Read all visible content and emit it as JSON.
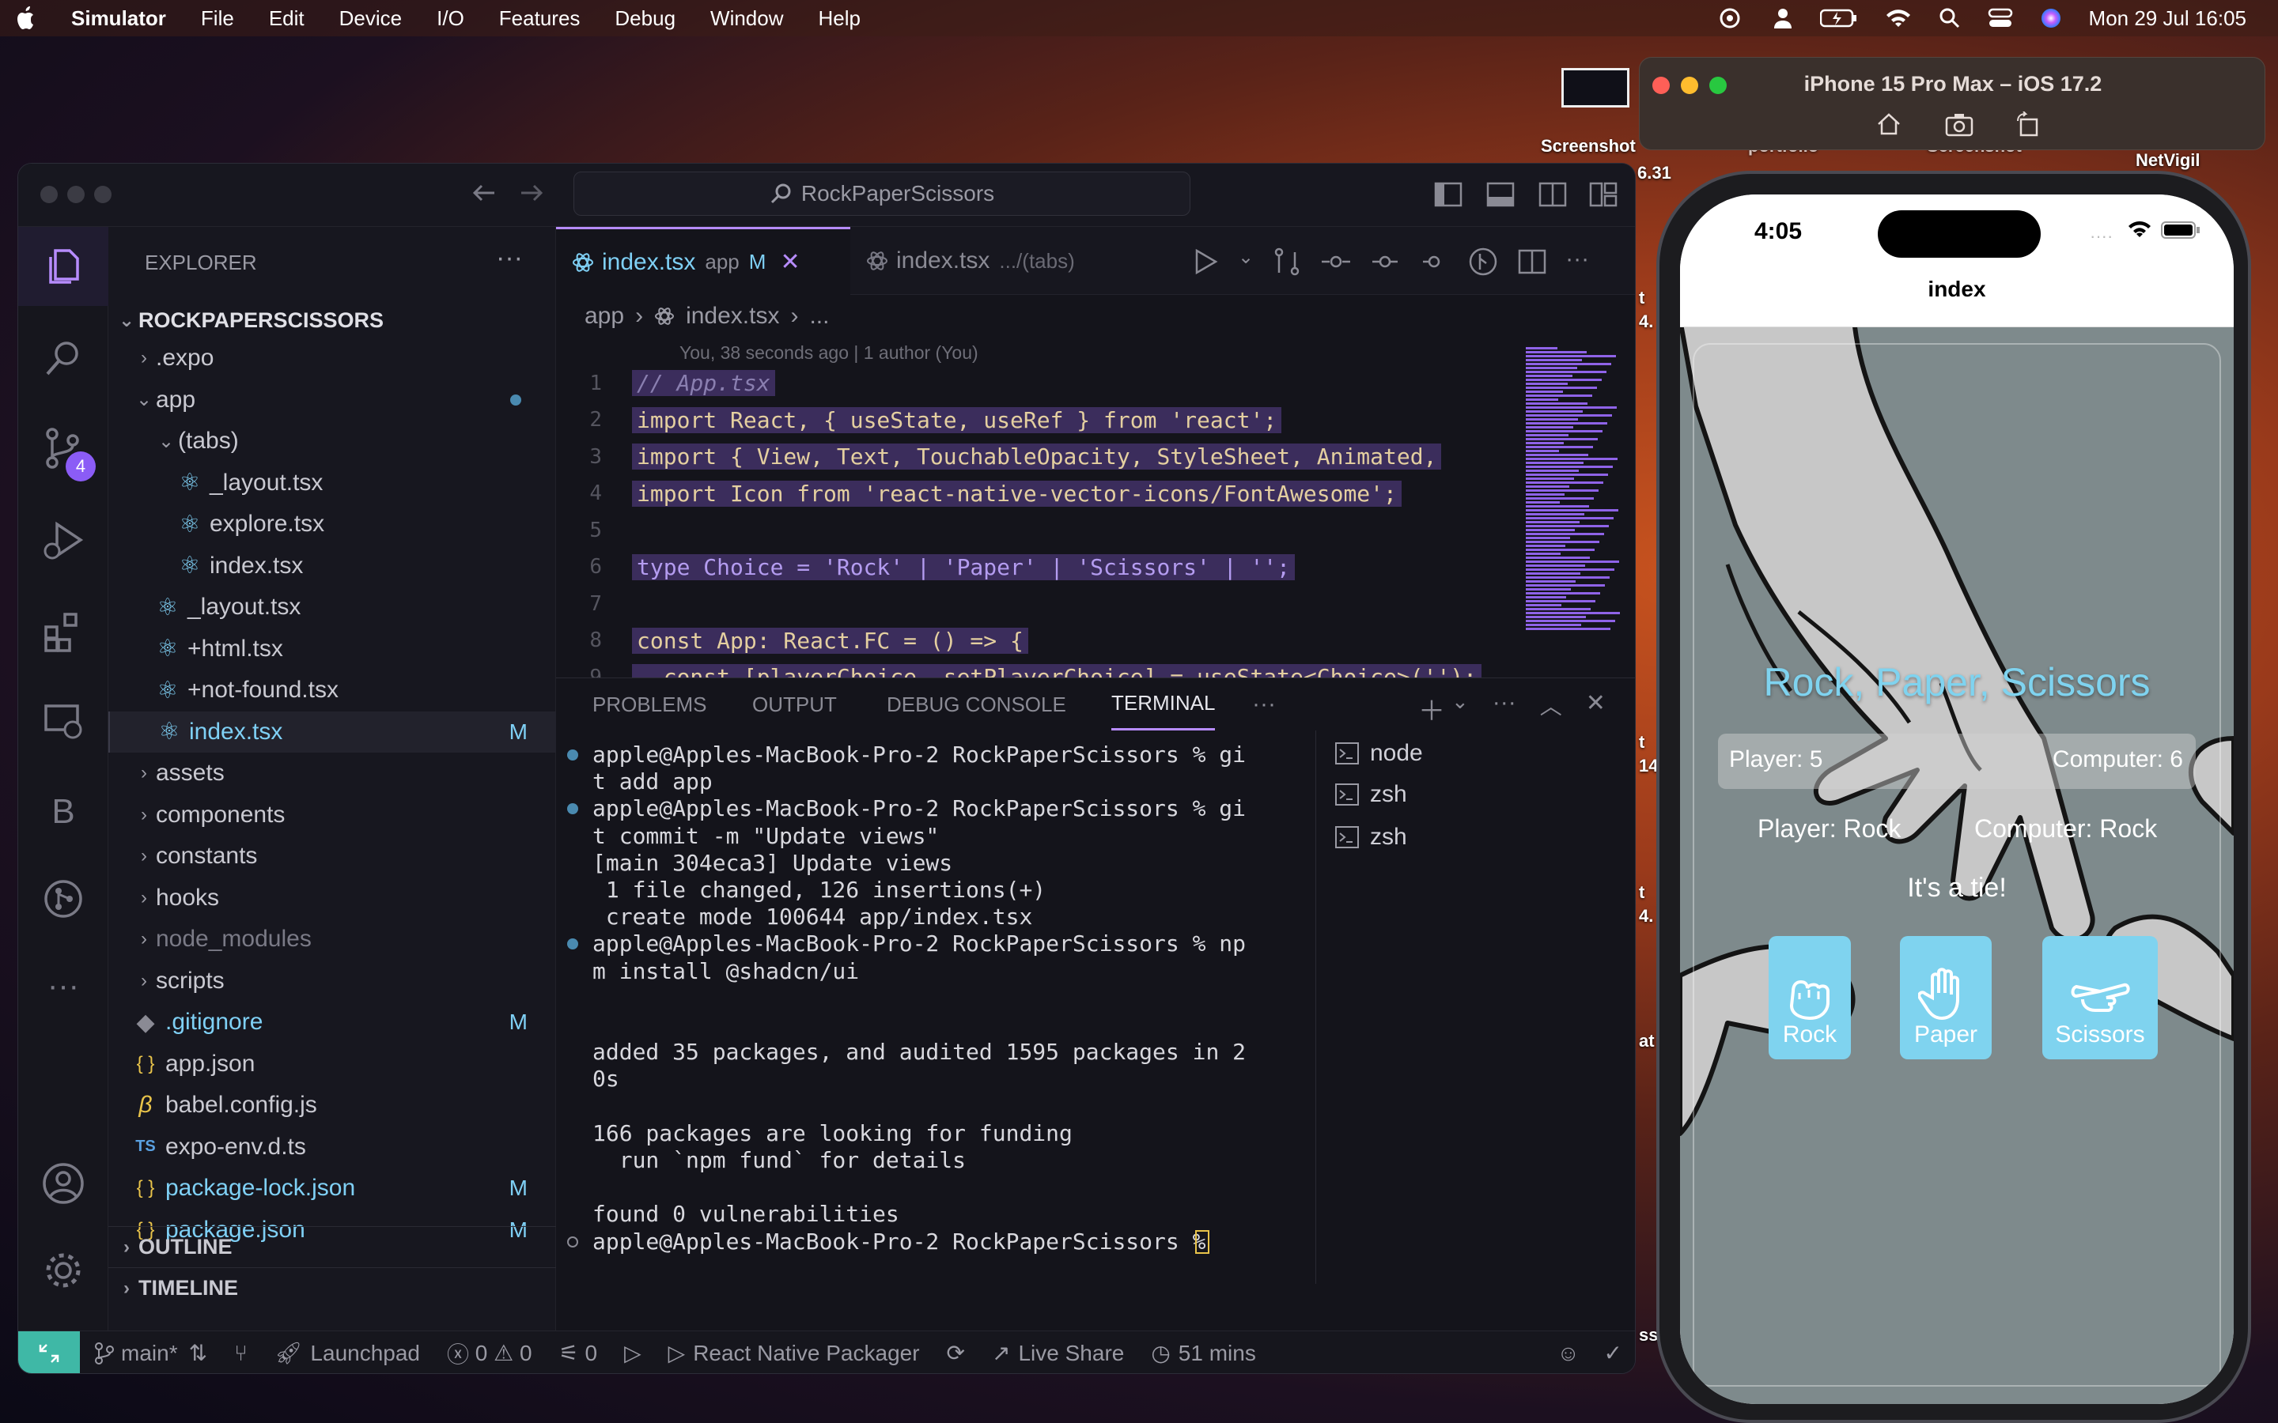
{
  "menubar": {
    "app": "Simulator",
    "items": [
      "File",
      "Edit",
      "Device",
      "I/O",
      "Features",
      "Debug",
      "Window",
      "Help"
    ],
    "datetime": "Mon 29 Jul  16:05"
  },
  "desktop": {
    "labels": [
      "Screenshot",
      "portfolio",
      "Screenshot",
      "NetVigil"
    ],
    "partial_labels": [
      "6.31",
      "t",
      "4.",
      "t",
      "14",
      "t",
      "4.",
      "at",
      "ss"
    ]
  },
  "vscode": {
    "search": "RockPaperScissors",
    "explorer": {
      "title": "EXPLORER",
      "root": "ROCKPAPERSCISSORS",
      "items": [
        {
          "label": ".expo",
          "chev": ">",
          "m": ""
        },
        {
          "label": "app",
          "chev": "v",
          "m": ""
        },
        {
          "label": "(tabs)",
          "chev": "v",
          "m": ""
        },
        {
          "label": "_layout.tsx",
          "chev": "",
          "m": ""
        },
        {
          "label": "explore.tsx",
          "chev": "",
          "m": ""
        },
        {
          "label": "index.tsx",
          "chev": "",
          "m": ""
        },
        {
          "label": "_layout.tsx",
          "chev": "",
          "m": ""
        },
        {
          "label": "+html.tsx",
          "chev": "",
          "m": ""
        },
        {
          "label": "+not-found.tsx",
          "chev": "",
          "m": ""
        },
        {
          "label": "index.tsx",
          "chev": "",
          "m": "M"
        },
        {
          "label": "assets",
          "chev": ">",
          "m": ""
        },
        {
          "label": "components",
          "chev": ">",
          "m": ""
        },
        {
          "label": "constants",
          "chev": ">",
          "m": ""
        },
        {
          "label": "hooks",
          "chev": ">",
          "m": ""
        },
        {
          "label": "node_modules",
          "chev": ">",
          "m": ""
        },
        {
          "label": "scripts",
          "chev": ">",
          "m": ""
        },
        {
          "label": ".gitignore",
          "chev": "",
          "m": "M"
        },
        {
          "label": "app.json",
          "chev": "",
          "m": ""
        },
        {
          "label": "babel.config.js",
          "chev": "",
          "m": ""
        },
        {
          "label": "expo-env.d.ts",
          "chev": "",
          "m": ""
        },
        {
          "label": "package-lock.json",
          "chev": "",
          "m": "M"
        },
        {
          "label": "package.json",
          "chev": "",
          "m": "M"
        }
      ],
      "outline": "OUTLINE",
      "timeline": "TIMELINE"
    },
    "source_control_badge": "4",
    "tabs": [
      {
        "name": "index.tsx",
        "detail": "app",
        "status": "M"
      },
      {
        "name": "index.tsx",
        "detail": ".../(tabs)"
      }
    ],
    "breadcrumb": [
      "app",
      "index.tsx",
      "..."
    ],
    "blame": "You, 38 seconds ago | 1 author (You)",
    "code": [
      "// App.tsx",
      "import React, { useState, useRef } from 'react';",
      "import { View, Text, TouchableOpacity, StyleSheet, Animated,",
      "import Icon from 'react-native-vector-icons/FontAwesome';",
      "",
      "type Choice = 'Rock' | 'Paper' | 'Scissors' | '';",
      "",
      "const App: React.FC = () => {",
      "  const [playerChoice, setPlayerChoice] = useState<Choice>('');"
    ],
    "panel_tabs": [
      "PROBLEMS",
      "OUTPUT",
      "DEBUG CONSOLE",
      "TERMINAL",
      "···"
    ],
    "terminal": [
      "apple@Apples-MacBook-Pro-2 RockPaperScissors % gi",
      "t add app",
      "apple@Apples-MacBook-Pro-2 RockPaperScissors % gi",
      "t commit -m \"Update views\"",
      "[main 304eca3] Update views",
      " 1 file changed, 126 insertions(+)",
      " create mode 100644 app/index.tsx",
      "apple@Apples-MacBook-Pro-2 RockPaperScissors % np",
      "m install @shadcn/ui",
      "",
      "",
      "added 35 packages, and audited 1595 packages in 2",
      "0s",
      "",
      "166 packages are looking for funding",
      "  run `npm fund` for details",
      "",
      "found 0 vulnerabilities",
      "apple@Apples-MacBook-Pro-2 RockPaperScissors % "
    ],
    "terminals": [
      "node",
      "zsh",
      "zsh"
    ],
    "status": {
      "branch": "main*",
      "launchpad": "Launchpad",
      "errors": "0",
      "warnings": "0",
      "ports": "0",
      "packager": "React Native Packager",
      "liveshare": "Live Share",
      "time": "51 mins"
    }
  },
  "simulator": {
    "title": "iPhone 15 Pro Max – iOS 17.2",
    "phone": {
      "time": "4:05",
      "nav_title": "index",
      "game_title": "Rock, Paper, Scissors",
      "player_score": "Player: 5",
      "computer_score": "Computer: 6",
      "player_choice": "Player: Rock",
      "computer_choice": "Computer: Rock",
      "result": "It's a tie!",
      "buttons": [
        "Rock",
        "Paper",
        "Scissors"
      ],
      "accent": "#7fd3ef"
    }
  }
}
